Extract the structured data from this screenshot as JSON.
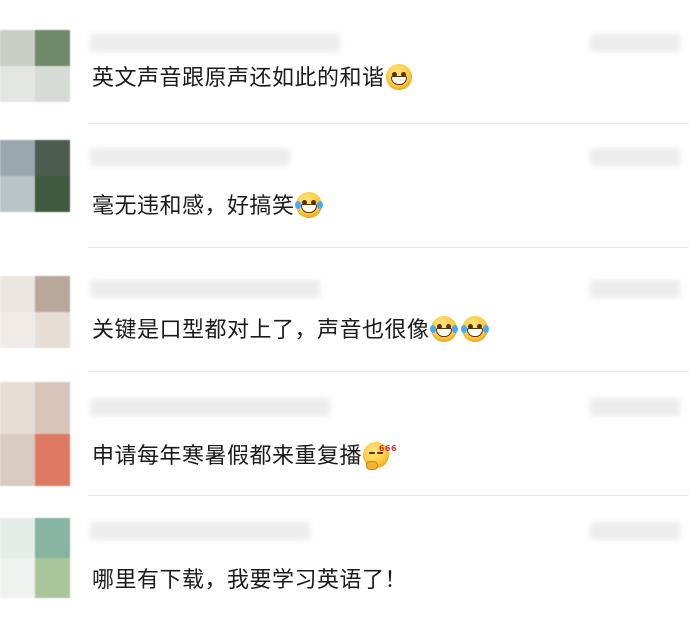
{
  "comments": [
    {
      "text": "英文声音跟原声还如此的和谐",
      "emoji": [
        "grin-icon"
      ]
    },
    {
      "text": "毫无违和感，好搞笑",
      "emoji": [
        "laugh-cry-icon"
      ]
    },
    {
      "text": "关键是口型都对上了，声音也很像",
      "emoji": [
        "laugh-cry-icon",
        "laugh-cry-icon"
      ]
    },
    {
      "text": "申请每年寒暑假都来重复播",
      "emoji": [
        "thinking-666-icon"
      ]
    },
    {
      "text": "哪里有下载，我要学习英语了！",
      "emoji": []
    }
  ],
  "emoji_tag": "666",
  "colors": {
    "divider": "#e8e8e8",
    "text": "#1a1a1a",
    "background": "#ffffff"
  }
}
